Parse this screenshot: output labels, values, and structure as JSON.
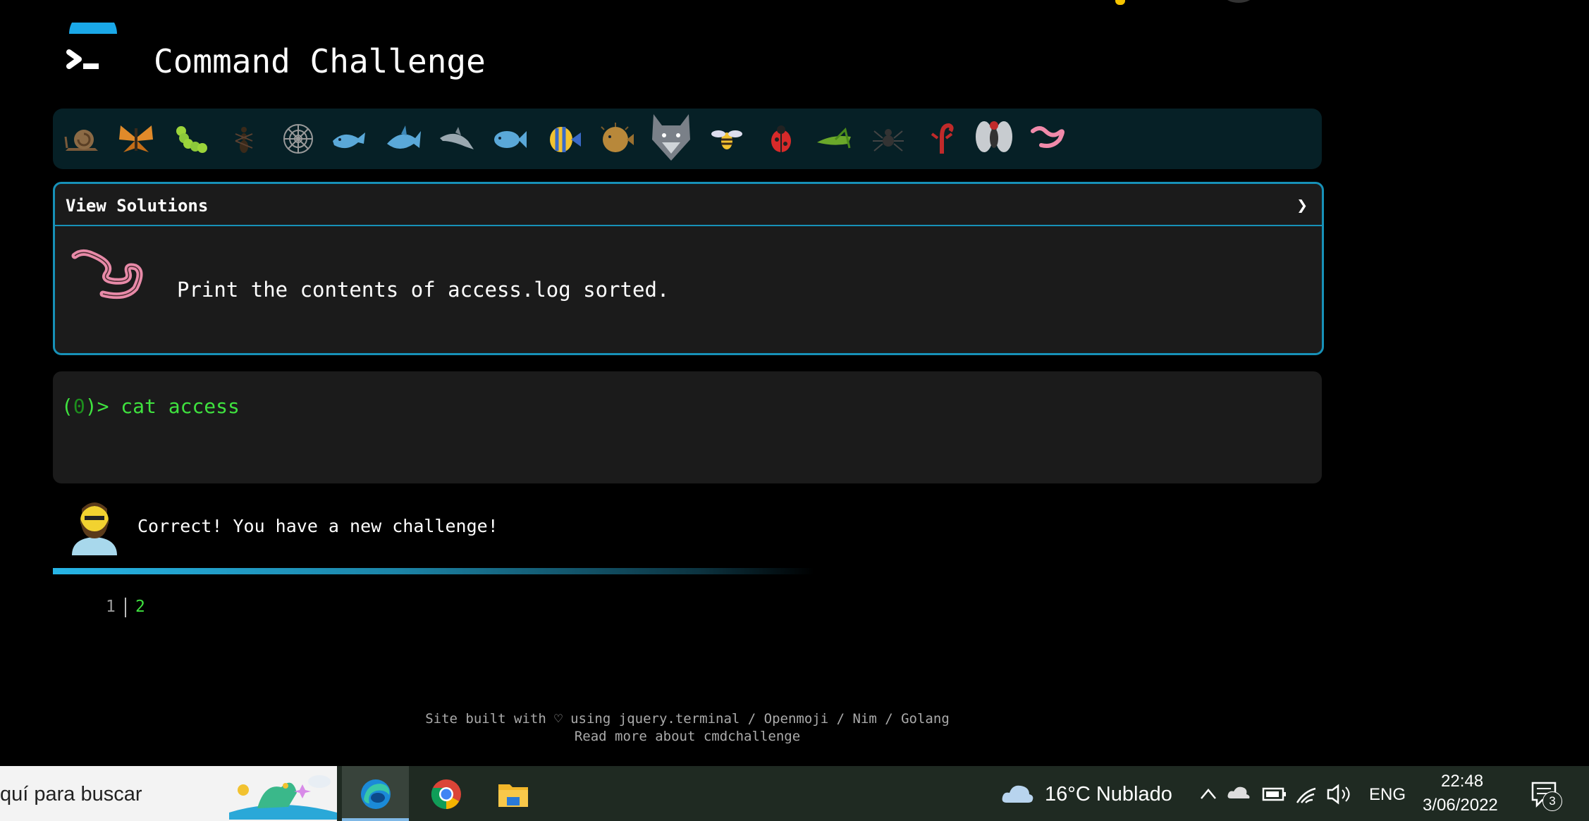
{
  "header": {
    "title": "Command Challenge"
  },
  "animals": [
    "snail",
    "butterfly",
    "caterpillar",
    "ant",
    "spider-web",
    "whale",
    "shark",
    "dolphin",
    "fish",
    "tropical-fish",
    "blowfish",
    "wolf",
    "bee",
    "ladybug",
    "grasshopper",
    "spider",
    "scorpion",
    "fly",
    "worm"
  ],
  "panel": {
    "header_label": "View Solutions",
    "chevron": "❯",
    "task": "Print the contents of access.log sorted."
  },
  "terminal": {
    "prompt_open": "(",
    "prompt_num": "0",
    "prompt_close": ")> ",
    "command": "cat access"
  },
  "feedback": {
    "message": "Correct! You have a new challenge!"
  },
  "levels": {
    "prev": "1",
    "current": "2"
  },
  "footer": {
    "line1": "Site built with ♡ using jquery.terminal / Openmoji / Nim / Golang",
    "line2": "Read more about cmdchallenge"
  },
  "taskbar": {
    "search_text": "quí para buscar",
    "weather": "16°C  Nublado",
    "language": "ENG",
    "time": "22:48",
    "date": "3/06/2022",
    "notifications": "3"
  },
  "colors": {
    "accent": "#1791b8",
    "prompt_green": "#3fe23f",
    "panel_bg": "#1b1b1b",
    "bar_bg": "#062026"
  }
}
